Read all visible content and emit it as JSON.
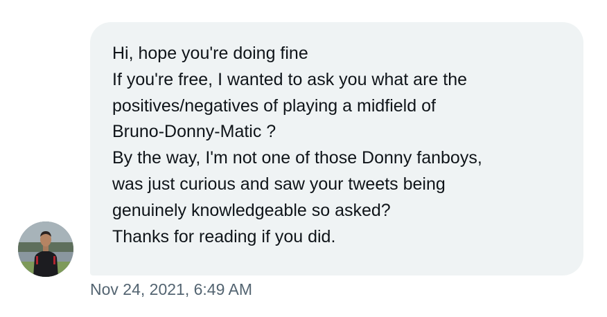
{
  "conversation": {
    "message": {
      "lines": [
        "Hi, hope you're doing fine",
        "If you're free, I wanted to ask you what are the",
        "positives/negatives of playing a midfield of",
        "Bruno-Donny-Matic ?",
        "By the way, I'm not one of those Donny fanboys,",
        "was just curious and saw your tweets being",
        "genuinely knowledgeable so asked?",
        "Thanks for reading if you did."
      ],
      "timestamp": "Nov 24, 2021, 6:49 AM"
    },
    "sender_avatar": {
      "icon": "user-avatar-photo"
    }
  },
  "colors": {
    "bubble_background": "#eff3f4",
    "message_text": "#0f1419",
    "timestamp_text": "#536471"
  }
}
